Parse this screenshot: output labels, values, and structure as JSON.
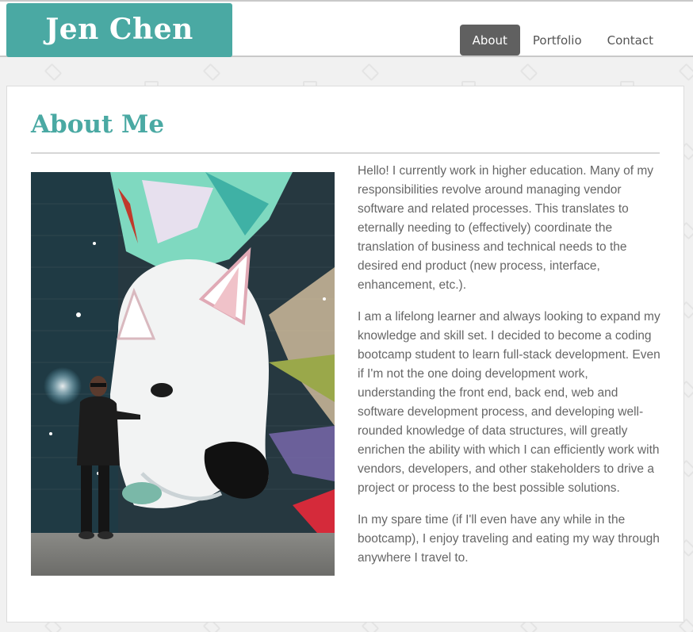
{
  "site": {
    "brand_name": "Jen Chen"
  },
  "nav": {
    "items": [
      {
        "label": "About",
        "active": true
      },
      {
        "label": "Portfolio",
        "active": false
      },
      {
        "label": "Contact",
        "active": false
      }
    ]
  },
  "about": {
    "title": "About Me",
    "photo_icon": "profile-photo",
    "paragraphs": [
      "Hello! I currently work in higher education. Many of my responsibilities revolve around managing vendor software and related processes. This translates to eternally needing to (effectively) coordinate the translation of business and technical needs to the desired end product (new process, interface, enhancement, etc.).",
      "I am a lifelong learner and always looking to expand my knowledge and skill set. I decided to become a coding bootcamp student to learn full-stack development. Even if I'm not the one doing development work, understanding the front end, back end, web and software development process, and developing well-rounded knowledge of data structures, will greatly enrichen the ability with which I can efficiently work with vendors, developers, and other stakeholders to drive a project or process to the best possible solutions.",
      "In my spare time (if I'll even have any while in the bootcamp), I enjoy traveling and eating my way through anywhere I travel to."
    ]
  },
  "colors": {
    "accent": "#4aa9a3",
    "nav_active_bg": "#606060"
  }
}
